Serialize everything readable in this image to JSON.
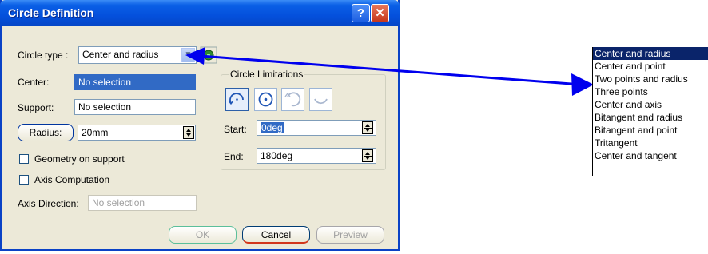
{
  "window": {
    "title": "Circle Definition",
    "help_glyph": "?",
    "close_glyph": "✕"
  },
  "circle_type": {
    "label": "Circle type :",
    "value": "Center and radius"
  },
  "center": {
    "label": "Center:",
    "value": "No selection"
  },
  "support": {
    "label": "Support:",
    "value": "No selection"
  },
  "radius": {
    "label": "Radius:",
    "value": "20mm"
  },
  "checkboxes": {
    "geometry_on_support": "Geometry on support",
    "axis_computation": "Axis Computation"
  },
  "axis_direction": {
    "label": "Axis Direction:",
    "value": "No selection"
  },
  "limitations": {
    "title": "Circle Limitations",
    "start_label": "Start:",
    "start_value": "0deg",
    "end_label": "End:",
    "end_value": "180deg"
  },
  "buttons": {
    "ok": "OK",
    "cancel": "Cancel",
    "preview": "Preview"
  },
  "type_list": [
    "Center and radius",
    "Center and point",
    "Two points and radius",
    "Three points",
    "Center and axis",
    "Bitangent and radius",
    "Bitangent and point",
    "Tritangent",
    "Center and tangent"
  ],
  "colors": {
    "arrow": "#0000ee",
    "title_bar": "#0450dc",
    "selection": "#0a246a"
  }
}
